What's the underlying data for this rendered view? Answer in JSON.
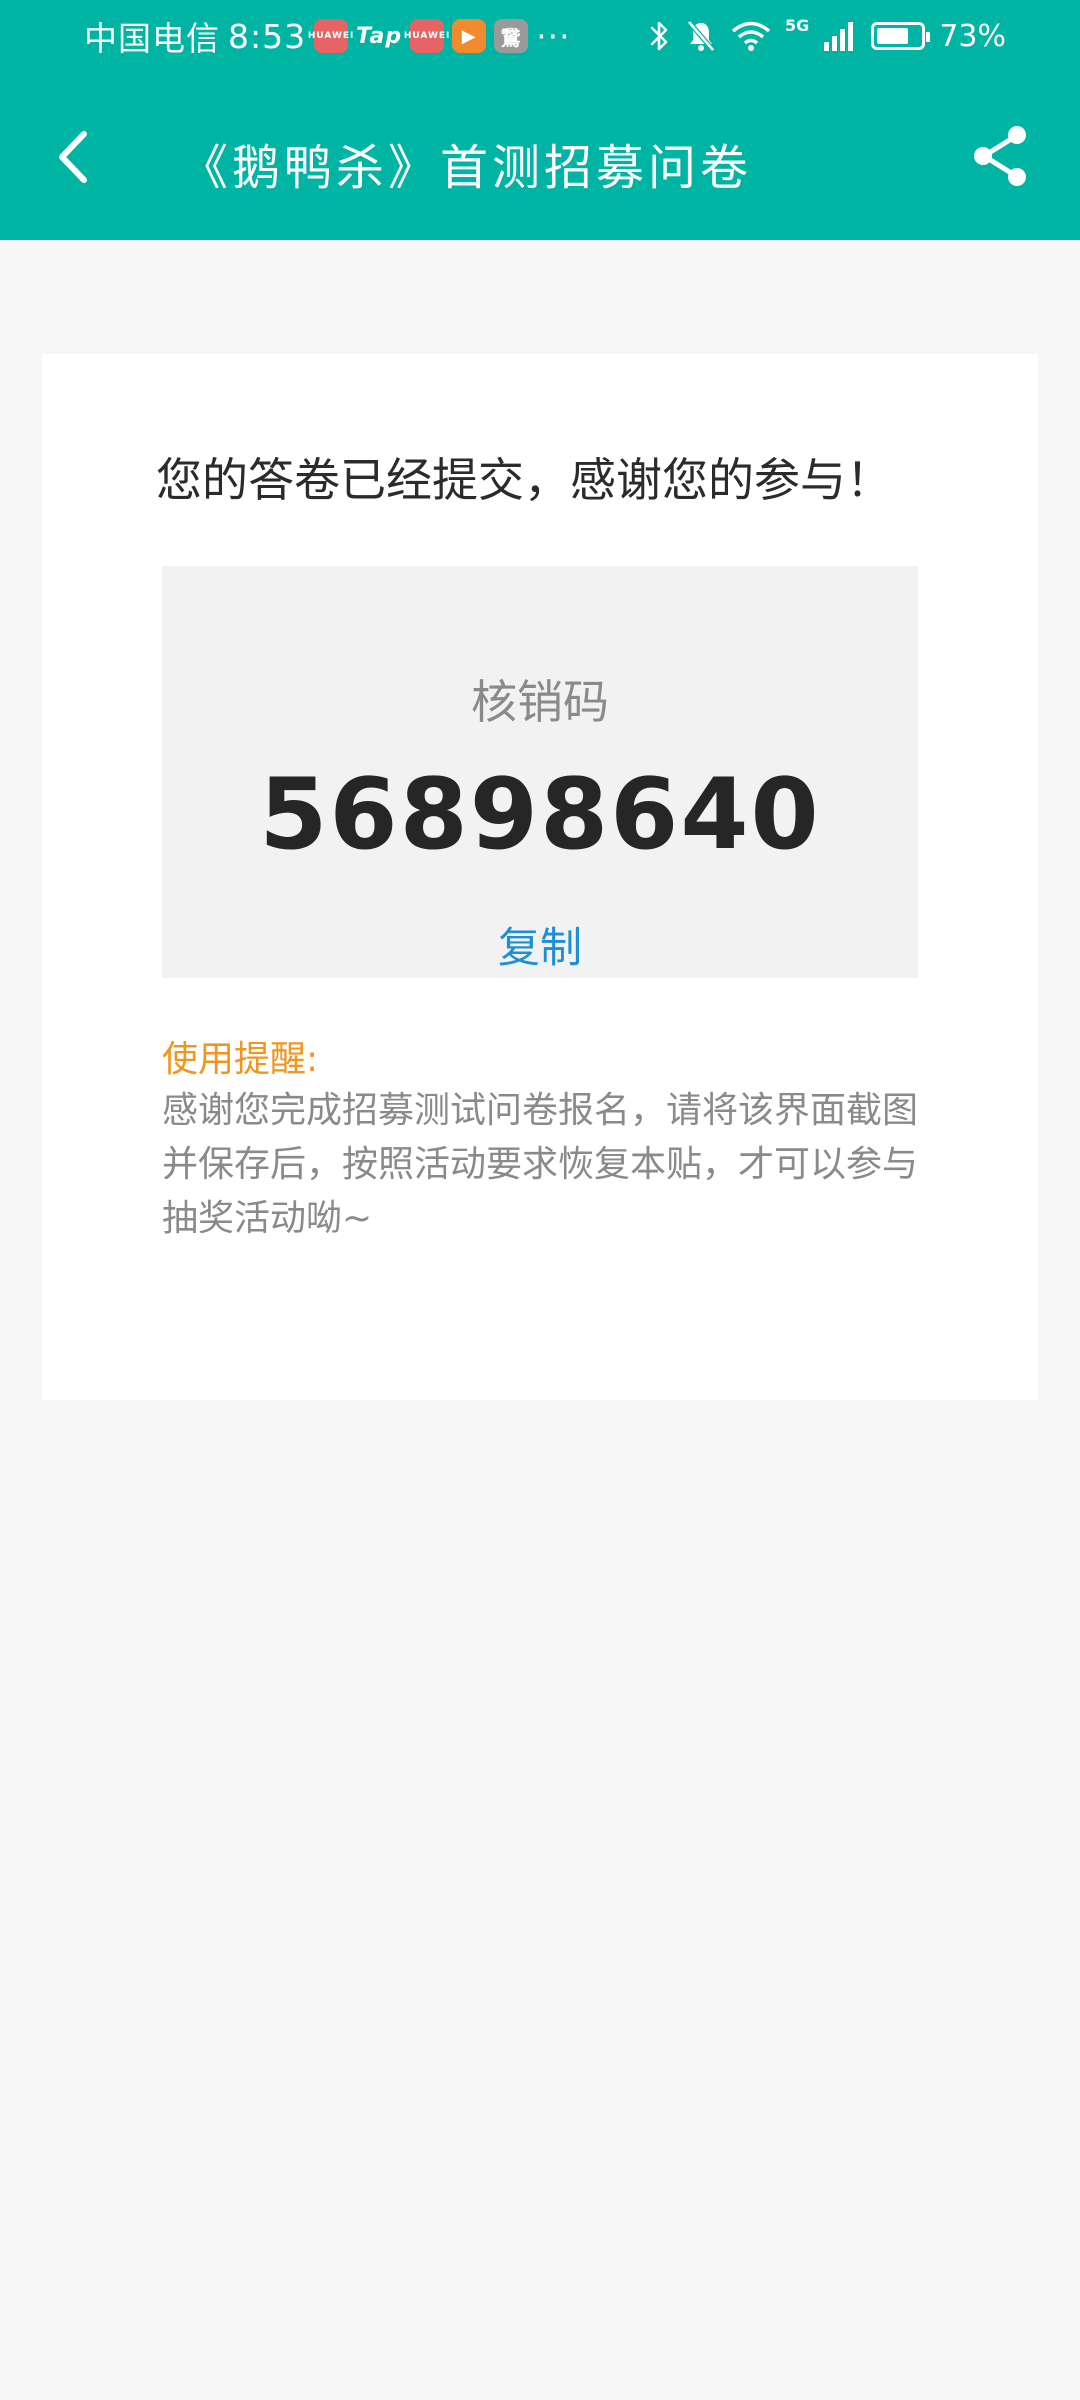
{
  "status_bar": {
    "carrier": "中国电信",
    "time": "8:53",
    "notification_apps": [
      {
        "name": "huawei-app-icon",
        "label": "HUAWEI"
      },
      {
        "name": "tap-app-icon",
        "label": "Tap"
      },
      {
        "name": "huawei-app-icon",
        "label": "HUAWEI"
      },
      {
        "name": "play-app-icon",
        "label": "▶"
      },
      {
        "name": "game-app-icon",
        "label": "鵞"
      }
    ],
    "more": "···",
    "network": "5G",
    "battery_percent": "73%",
    "battery_level": 0.73
  },
  "header": {
    "title": "《鹅鸭杀》首测招募问卷",
    "background_color": "#00b4a4"
  },
  "card": {
    "heading": "您的答卷已经提交，感谢您的参与！",
    "code_label": "核销码",
    "code_value": "56898640",
    "copy_label": "复制"
  },
  "reminder": {
    "title": "使用提醒:",
    "text": "感谢您完成招募测试问卷报名，请将该界面截图并保存后，按照活动要求恢复本贴，才可以参与抽奖活动呦~",
    "title_color": "#f0961e"
  }
}
